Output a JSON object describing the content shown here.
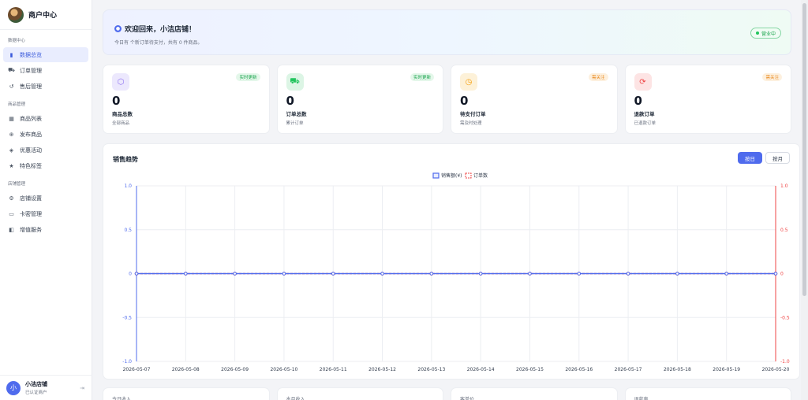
{
  "brand": {
    "name": "商户中心"
  },
  "sidebar": {
    "sections": [
      {
        "title": "数据中心",
        "items": [
          {
            "label": "数据总览",
            "icon": "bar-chart-icon",
            "glyph": "▮",
            "active": true
          },
          {
            "label": "订单管理",
            "icon": "cart-icon",
            "glyph": "⛟",
            "active": false
          },
          {
            "label": "售后管理",
            "icon": "undo-icon",
            "glyph": "↺",
            "active": false
          }
        ]
      },
      {
        "title": "商品管理",
        "items": [
          {
            "label": "商品列表",
            "icon": "grid-icon",
            "glyph": "▦",
            "active": false
          },
          {
            "label": "发布商品",
            "icon": "plus-circle-icon",
            "glyph": "⊕",
            "active": false
          },
          {
            "label": "优惠活动",
            "icon": "tag-icon",
            "glyph": "◈",
            "active": false
          },
          {
            "label": "特色标签",
            "icon": "star-icon",
            "glyph": "★",
            "active": false
          }
        ]
      },
      {
        "title": "店铺管理",
        "items": [
          {
            "label": "店铺设置",
            "icon": "gear-icon",
            "glyph": "⚙",
            "active": false
          },
          {
            "label": "卡密管理",
            "icon": "card-icon",
            "glyph": "▭",
            "active": false
          },
          {
            "label": "增值服务",
            "icon": "gift-icon",
            "glyph": "◧",
            "active": false
          }
        ]
      }
    ]
  },
  "user": {
    "avatar": "小",
    "name": "小洁店铺",
    "role": "已认证商户"
  },
  "welcome": {
    "title": "欢迎回来，小洁店铺！",
    "subtitle": "今日有 个新订单待支付，共有 0 件商品。",
    "status": "营业中"
  },
  "stats": [
    {
      "value": "0",
      "label": "商品总数",
      "sub": "全部商品",
      "tag": "实时更新",
      "icon": "package-icon",
      "glyph": "⬡",
      "icon_bg": "#ece8fd",
      "icon_color": "#8b6ef0",
      "tag_bg": "#e4f7ea",
      "tag_color": "#16a34a"
    },
    {
      "value": "0",
      "label": "订单总数",
      "sub": "累计订单",
      "tag": "实时更新",
      "icon": "cart-icon",
      "glyph": "⛟",
      "icon_bg": "#dcf5e5",
      "icon_color": "#22c55e",
      "tag_bg": "#e4f7ea",
      "tag_color": "#16a34a"
    },
    {
      "value": "0",
      "label": "待支付订单",
      "sub": "需及时处理",
      "tag": "需关注",
      "icon": "clock-icon",
      "glyph": "◷",
      "icon_bg": "#fdf1d8",
      "icon_color": "#f59e0b",
      "tag_bg": "#fdf0de",
      "tag_color": "#ea8a1f"
    },
    {
      "value": "0",
      "label": "退款订单",
      "sub": "已退款订单",
      "tag": "需关注",
      "icon": "refresh-icon",
      "glyph": "⟳",
      "icon_bg": "#fde4e4",
      "icon_color": "#ef4444",
      "tag_bg": "#fdf0de",
      "tag_color": "#ea8a1f"
    }
  ],
  "chart_section": {
    "title": "销售趋势",
    "buttons": [
      {
        "label": "按日",
        "active": true
      },
      {
        "label": "按月",
        "active": false
      }
    ]
  },
  "chart_data": {
    "type": "line",
    "x": [
      "2026-05-07",
      "2026-05-08",
      "2026-05-09",
      "2026-05-10",
      "2026-05-11",
      "2026-05-12",
      "2026-05-13",
      "2026-05-14",
      "2026-05-15",
      "2026-05-16",
      "2026-05-17",
      "2026-05-18",
      "2026-05-19",
      "2026-05-20"
    ],
    "series": [
      {
        "name": "销售额(¥)",
        "values": [
          0,
          0,
          0,
          0,
          0,
          0,
          0,
          0,
          0,
          0,
          0,
          0,
          0,
          0
        ],
        "color": "#4f6bed",
        "axis": "left"
      },
      {
        "name": "订单数",
        "values": [
          0,
          0,
          0,
          0,
          0,
          0,
          0,
          0,
          0,
          0,
          0,
          0,
          0,
          0
        ],
        "color": "#ef4444",
        "axis": "right"
      }
    ],
    "y_left": {
      "ticks": [
        "1.0",
        "0.5",
        "0",
        "-0.5",
        "-1.0"
      ],
      "range": [
        -1,
        1
      ]
    },
    "y_right": {
      "ticks": [
        "1.0",
        "0.5",
        "0",
        "-0.5",
        "-1.0"
      ],
      "range": [
        -1,
        1
      ]
    },
    "legend": "top-center",
    "grid": true
  },
  "bottom_cards": [
    {
      "label": "今日收入"
    },
    {
      "label": "本月收入"
    },
    {
      "label": "客单价"
    },
    {
      "label": "退款率"
    }
  ]
}
